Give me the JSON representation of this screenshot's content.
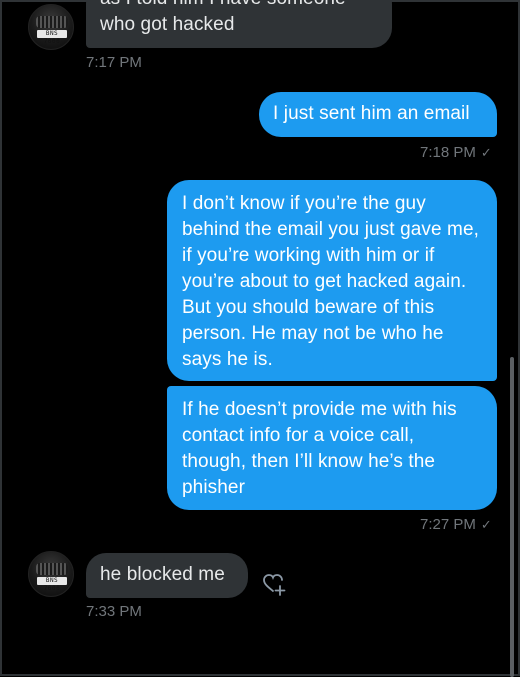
{
  "messages": [
    {
      "text_top": "as I told him I have someone",
      "text": "who got hacked",
      "time": "7:17 PM"
    },
    {
      "text": "I just sent him an email",
      "time": "7:18 PM"
    },
    {
      "text": "I don’t know if you’re the guy behind the email you just gave me, if you’re working with him or if you’re about to get hacked again. But you should beware of this person. He may not be who he says he is."
    },
    {
      "text": "If he doesn’t provide me with his contact info for a voice call, though, then I’ll know he’s the phisher",
      "time": "7:27 PM"
    },
    {
      "text": "he blocked me",
      "time": "7:33 PM"
    }
  ],
  "avatar": {
    "plate_text": "BNS 7000"
  },
  "icons": {
    "read_check": "checkmark-icon",
    "react": "heart-plus-icon"
  },
  "colors": {
    "outgoing": "#1d9bf0",
    "incoming": "#2f3336",
    "background": "#000000",
    "timestamp": "#71767b"
  }
}
